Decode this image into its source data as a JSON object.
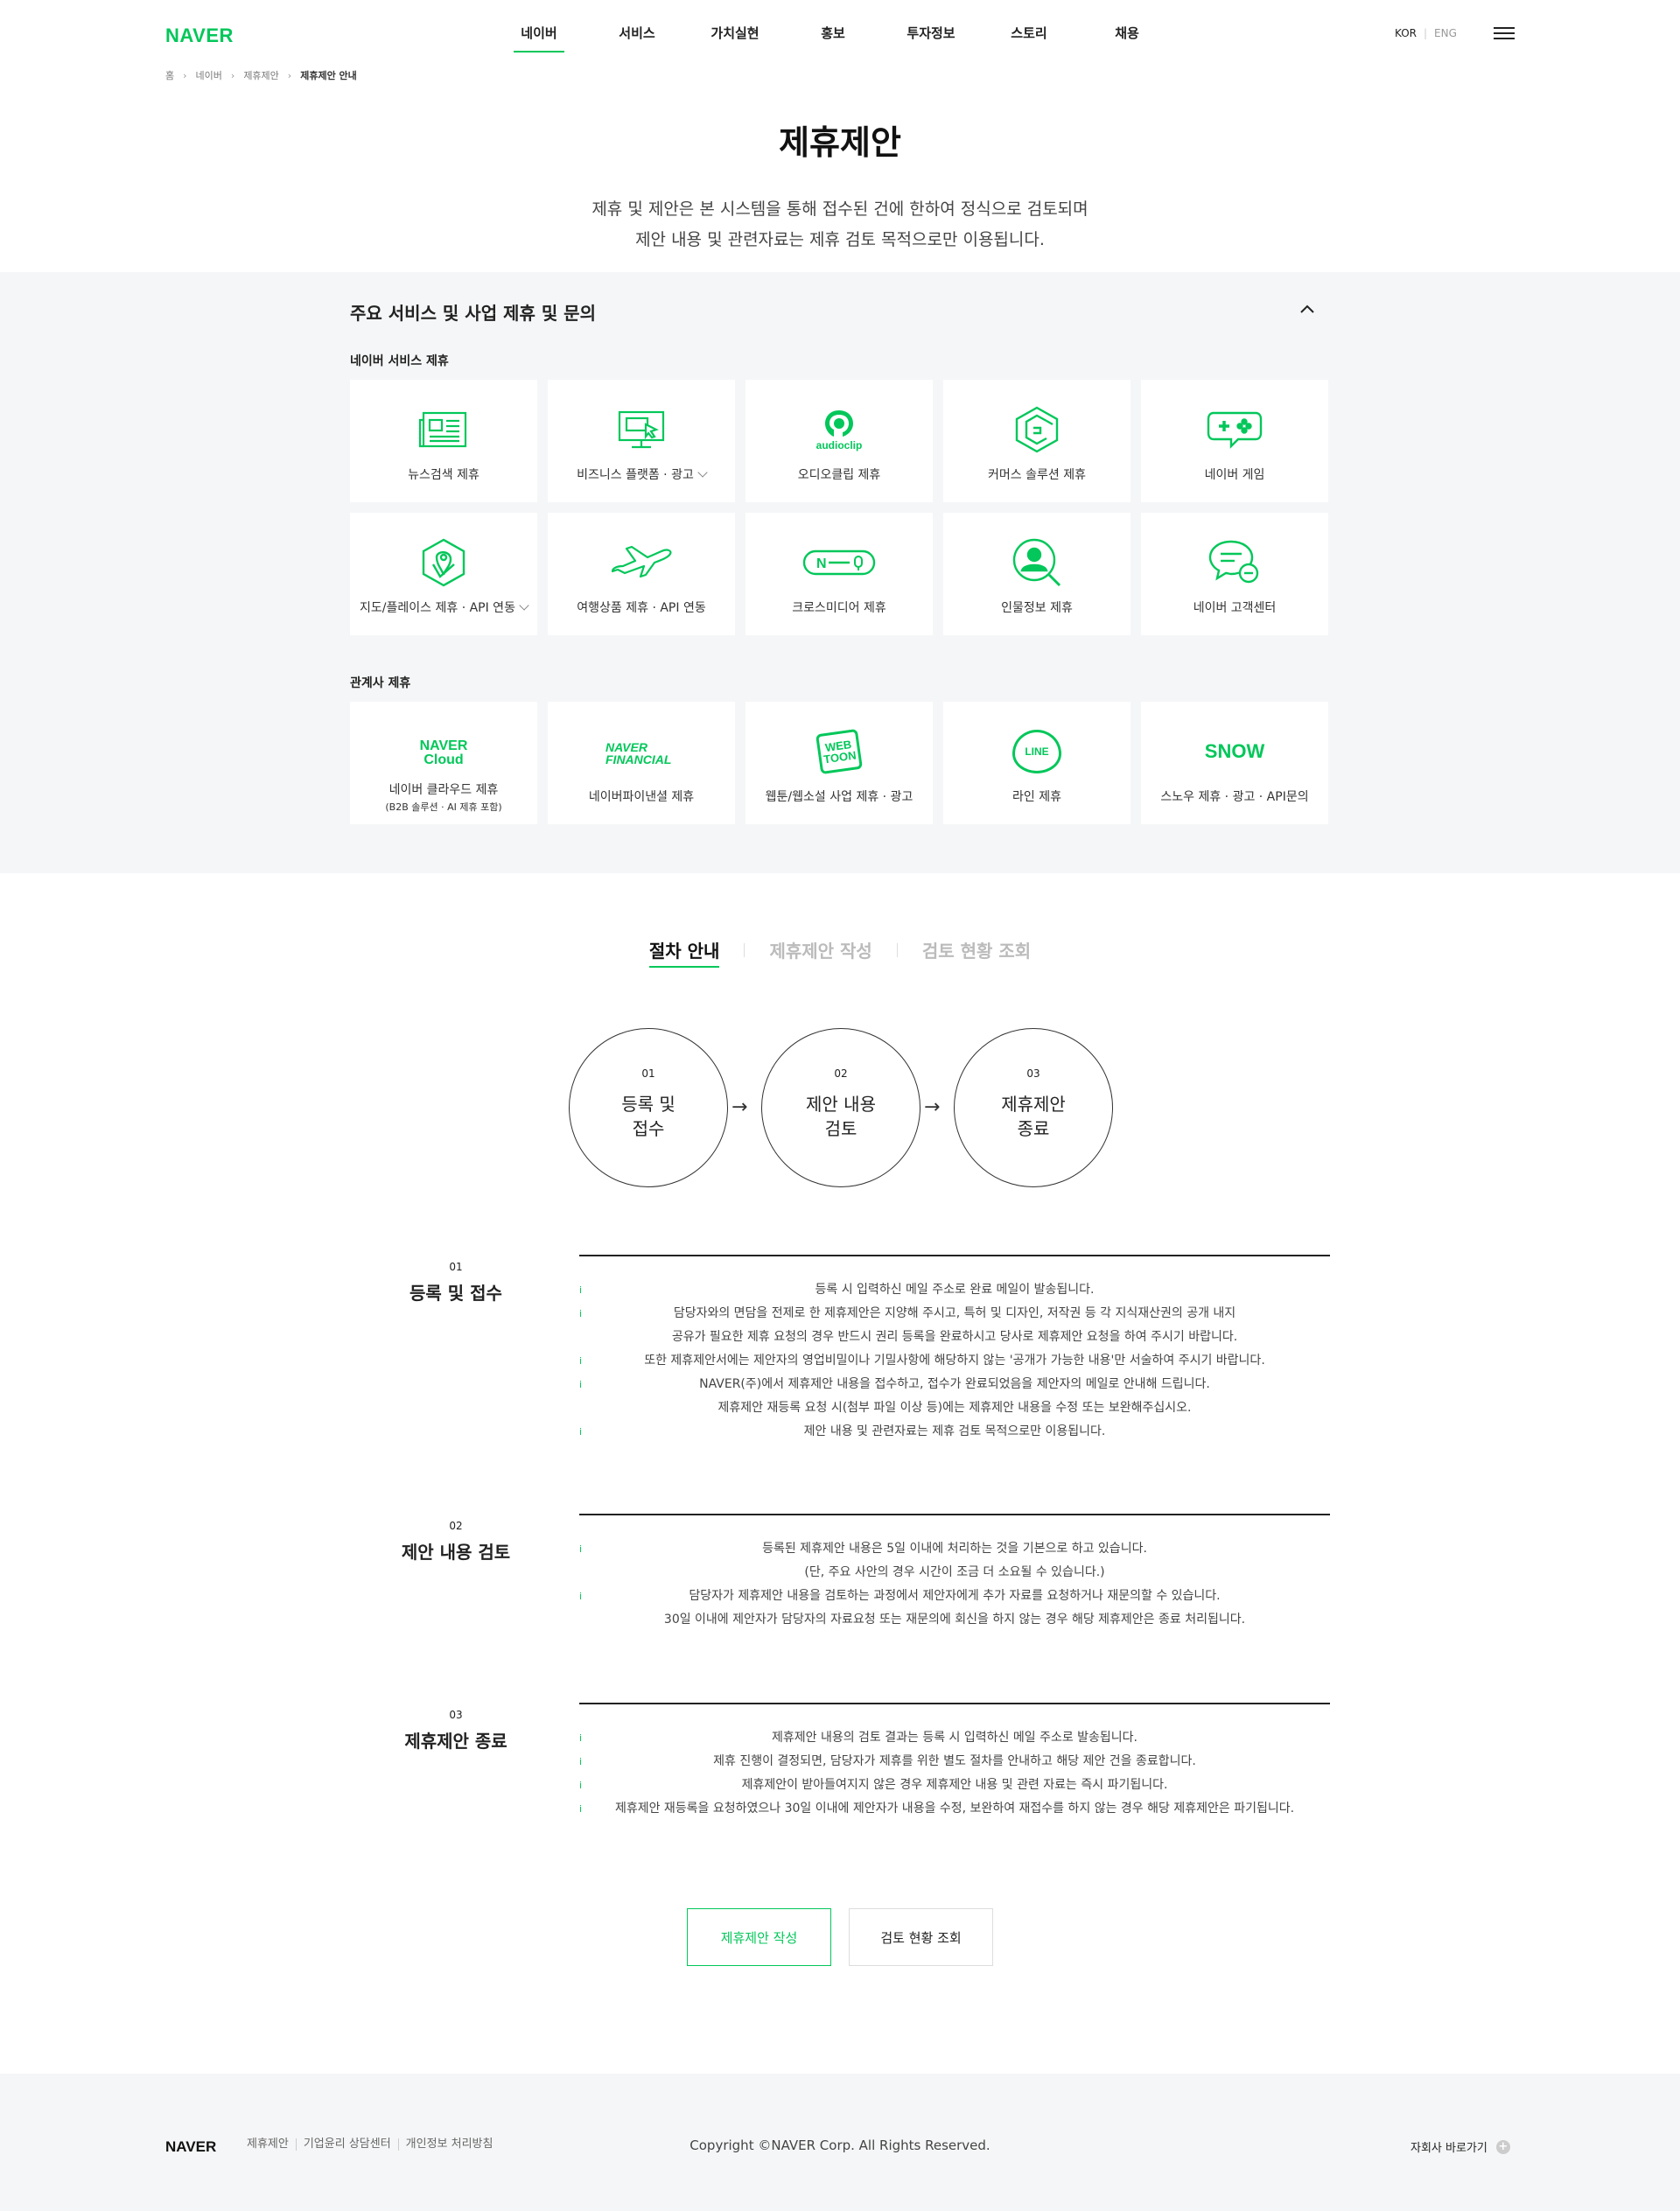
{
  "header": {
    "logo": "NAVER",
    "nav": [
      "네이버",
      "서비스",
      "가치실현",
      "홍보",
      "투자정보",
      "스토리",
      "채용"
    ],
    "lang_kor": "KOR",
    "lang_eng": "ENG"
  },
  "breadcrumb": [
    "홈",
    "네이버",
    "제휴제안",
    "제휴제안 안내"
  ],
  "page": {
    "title": "제휴제안",
    "desc_line1": "제휴 및 제안은 본 시스템을 통해 접수된 건에 한하여 정식으로 검토되며",
    "desc_line2": "제안 내용 및 관련자료는 제휴 검토 목적으로만 이용됩니다."
  },
  "partnership": {
    "heading": "주요 서비스 및 사업 제휴 및 문의",
    "naver_heading": "네이버 서비스 제휴",
    "naver_items": [
      {
        "label": "뉴스검색 제휴",
        "icon": "news-icon"
      },
      {
        "label": "비즈니스 플랫폼 · 광고",
        "icon": "monitor-cursor-icon"
      },
      {
        "label": "오디오클립 제휴",
        "icon": "audioclip-icon",
        "brand": "audioclip"
      },
      {
        "label": "커머스 솔루션 제휴",
        "icon": "commerce-hexagon-icon"
      },
      {
        "label": "네이버 게임",
        "icon": "gamepad-icon"
      },
      {
        "label": "지도/플레이스 제휴 · API 연동",
        "icon": "map-hexagon-icon"
      },
      {
        "label": "여행상품 제휴 · API 연동",
        "icon": "airplane-icon"
      },
      {
        "label": "크로스미디어 제휴",
        "icon": "crossmedia-icon",
        "brand": "N"
      },
      {
        "label": "인물정보 제휴",
        "icon": "person-search-icon"
      },
      {
        "label": "네이버 고객센터",
        "icon": "chat-bubble-icon"
      }
    ],
    "affiliate_heading": "관계사 제휴",
    "affiliate_items": [
      {
        "label": "네이버 클라우드 제휴",
        "sub": "(B2B 솔루션 · AI 제휴 포함)",
        "brand_line1": "NAVER",
        "brand_line2": "Cloud"
      },
      {
        "label": "네이버파이낸셜 제휴",
        "brand_line1": "NAVER",
        "brand_line2": "FINANCIAL"
      },
      {
        "label": "웹툰/웹소설 사업 제휴 · 광고",
        "brand_line1": "WEB",
        "brand_line2": "TOON"
      },
      {
        "label": "라인 제휴",
        "brand_line1": "LINE"
      },
      {
        "label": "스노우 제휴 · 광고 · API문의",
        "brand_line1": "SNOW"
      }
    ]
  },
  "tabs": [
    "절차 안내",
    "제휴제안 작성",
    "검토 현황 조회"
  ],
  "steps": [
    {
      "num": "01",
      "line1": "등록 및",
      "line2": "접수"
    },
    {
      "num": "02",
      "line1": "제안 내용",
      "line2": "검토"
    },
    {
      "num": "03",
      "line1": "제휴제안",
      "line2": "종료"
    }
  ],
  "step_arrow": "→",
  "sections": [
    {
      "num": "01",
      "title": "등록 및 접수",
      "items": [
        {
          "text": "등록 시 입력하신 메일 주소로 완료 메일이 발송됩니다.",
          "bullet": true
        },
        {
          "text": "담당자와의 면담을 전제로 한 제휴제안은 지양해 주시고, 특허 및 디자인, 저작권 등 각 지식재산권의 공개 내지",
          "bullet": true
        },
        {
          "text": "공유가 필요한 제휴 요청의 경우 반드시 권리 등록을 완료하시고 당사로 제휴제안 요청을 하여 주시기 바랍니다.",
          "bullet": false
        },
        {
          "text": "또한 제휴제안서에는 제안자의 영업비밀이나 기밀사항에 해당하지 않는 '공개가 가능한 내용'만 서술하여 주시기 바랍니다.",
          "bullet": true
        },
        {
          "text": "NAVER(주)에서 제휴제안 내용을 접수하고, 접수가 완료되었음을 제안자의 메일로 안내해 드립니다.",
          "bullet": true
        },
        {
          "text": "제휴제안 재등록 요청 시(첨부 파일 이상 등)에는 제휴제안 내용을 수정 또는 보완해주십시오.",
          "bullet": false
        },
        {
          "text": "제안 내용 및 관련자료는 제휴 검토 목적으로만 이용됩니다.",
          "bullet": true
        }
      ]
    },
    {
      "num": "02",
      "title": "제안 내용 검토",
      "items": [
        {
          "text": "등록된 제휴제안 내용은 5일 이내에 처리하는 것을 기본으로 하고 있습니다.",
          "bullet": true
        },
        {
          "text": "(단, 주요 사안의 경우 시간이 조금 더 소요될 수 있습니다.)",
          "bullet": false
        },
        {
          "text": "담당자가 제휴제안 내용을 검토하는 과정에서 제안자에게 추가 자료를 요청하거나 재문의할 수 있습니다.",
          "bullet": true
        },
        {
          "text": "30일 이내에 제안자가 담당자의 자료요청 또는 재문의에 회신을 하지 않는 경우 해당 제휴제안은 종료 처리됩니다.",
          "bullet": false
        }
      ]
    },
    {
      "num": "03",
      "title": "제휴제안 종료",
      "items": [
        {
          "text": "제휴제안 내용의 검토 결과는 등록 시 입력하신 메일 주소로 발송됩니다.",
          "bullet": true
        },
        {
          "text": "제휴 진행이 결정되면, 담당자가 제휴를 위한 별도 절차를 안내하고 해당 제안 건을 종료합니다.",
          "bullet": true
        },
        {
          "text": "제휴제안이 받아들여지지 않은 경우 제휴제안 내용 및 관련 자료는 즉시 파기됩니다.",
          "bullet": true
        },
        {
          "text": "제휴제안 재등록을 요청하였으나 30일 이내에 제안자가 내용을 수정, 보완하여 재접수를 하지 않는 경우 해당 제휴제안은 파기됩니다.",
          "bullet": true
        }
      ]
    }
  ],
  "bullet_glyph": "i",
  "buttons": {
    "write": "제휴제안 작성",
    "status": "검토 현황 조회"
  },
  "footer": {
    "logo": "NAVER",
    "links": [
      "제휴제안",
      "기업윤리 상담센터",
      "개인정보 처리방침"
    ],
    "copyright": "Copyright ©NAVER Corp. All Rights Reserved.",
    "family": "자회사 바로가기",
    "family_plus": "+"
  },
  "colors": {
    "accent": "#03c75a",
    "panel_bg": "#f5f6f7",
    "text": "#222222"
  }
}
